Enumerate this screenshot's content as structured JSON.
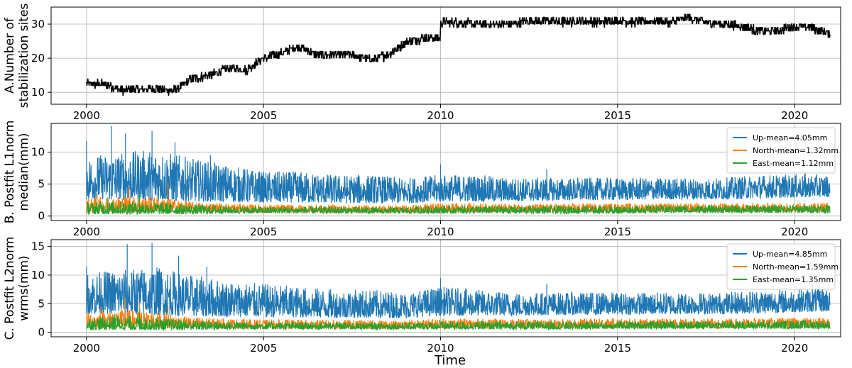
{
  "figure": {
    "xlabel": "Time"
  },
  "chart_data": [
    {
      "id": "A",
      "type": "line",
      "ylabel_lines": [
        "A.Number of",
        "stabilization sites"
      ],
      "xlim": [
        1999.0,
        2021.3
      ],
      "ylim": [
        6.5,
        35
      ],
      "xticks": [
        2000,
        2005,
        2010,
        2015,
        2020
      ],
      "yticks": [
        10,
        20,
        30
      ],
      "grid": true,
      "series": [
        {
          "color": "#000000",
          "noise": 1.3,
          "x": [
            2000.0,
            2000.5,
            2001.0,
            2001.5,
            2002.0,
            2002.5,
            2003.0,
            2003.5,
            2004.0,
            2004.5,
            2005.0,
            2005.5,
            2006.0,
            2006.5,
            2007.0,
            2007.5,
            2008.0,
            2008.5,
            2009.0,
            2009.5,
            2009.99,
            2010.01,
            2010.5,
            2011.0,
            2011.5,
            2012.0,
            2012.5,
            2013.0,
            2013.5,
            2014.0,
            2014.5,
            2015.0,
            2015.5,
            2016.0,
            2016.5,
            2017.0,
            2017.5,
            2018.0,
            2018.5,
            2019.0,
            2019.5,
            2020.0,
            2020.5,
            2021.0
          ],
          "y": [
            12.5,
            12.5,
            10.5,
            11.0,
            11.0,
            10.5,
            14.0,
            15.0,
            17.0,
            16.5,
            20.0,
            21.5,
            23.5,
            21.0,
            21.0,
            21.0,
            19.5,
            21.0,
            24.5,
            26.0,
            26.0,
            30.5,
            30.5,
            30.0,
            30.0,
            30.0,
            31.0,
            31.0,
            30.5,
            31.0,
            30.5,
            31.0,
            30.5,
            31.0,
            30.5,
            32.0,
            30.5,
            30.0,
            29.5,
            28.0,
            28.0,
            29.5,
            29.0,
            27.0
          ]
        }
      ]
    },
    {
      "id": "B",
      "type": "line",
      "ylabel_lines": [
        "B. Postfit L1norm",
        "median(mm)"
      ],
      "xlim": [
        1999.0,
        2021.3
      ],
      "ylim": [
        -0.7,
        14.5
      ],
      "xticks": [
        2000,
        2005,
        2010,
        2015,
        2020
      ],
      "yticks": [
        0,
        5,
        10
      ],
      "grid": true,
      "series": [
        {
          "name": "Up-mean=4.05mm",
          "color": "#1f77b4",
          "x": [
            2000,
            2001,
            2002,
            2003,
            2004,
            2005,
            2006,
            2007,
            2008,
            2009,
            2010,
            2011,
            2012,
            2013,
            2014,
            2015,
            2016,
            2017,
            2018,
            2019,
            2020,
            2021
          ],
          "y_low": [
            2.6,
            2.6,
            2.4,
            2.3,
            2.2,
            2.1,
            2.1,
            2.0,
            2.0,
            2.0,
            2.3,
            2.3,
            2.3,
            2.4,
            2.5,
            2.5,
            2.6,
            2.6,
            2.6,
            2.8,
            2.9,
            3.0
          ],
          "y_high": [
            9.5,
            10.0,
            10.5,
            9.0,
            8.0,
            7.0,
            7.0,
            6.5,
            6.5,
            6.0,
            6.5,
            6.5,
            6.0,
            6.0,
            6.0,
            6.0,
            6.0,
            6.0,
            6.0,
            6.5,
            6.5,
            6.5
          ],
          "spikes": [
            [
              2000.0,
              11.7
            ],
            [
              2000.7,
              14.1
            ],
            [
              2001.1,
              12.9
            ],
            [
              2001.85,
              13.3
            ],
            [
              2002.5,
              11.5
            ],
            [
              2003.5,
              9.5
            ],
            [
              2010.0,
              8.1
            ],
            [
              2013.0,
              7.3
            ],
            [
              2020.3,
              7.0
            ]
          ]
        },
        {
          "name": "North-mean=1.32mm",
          "color": "#ff7f0e",
          "x": [
            2000,
            2001,
            2002,
            2003,
            2004,
            2005,
            2006,
            2007,
            2008,
            2009,
            2010,
            2011,
            2012,
            2013,
            2014,
            2015,
            2016,
            2017,
            2018,
            2019,
            2020,
            2021
          ],
          "y_low": [
            0.6,
            0.6,
            0.6,
            0.6,
            0.6,
            0.5,
            0.5,
            0.5,
            0.5,
            0.5,
            0.6,
            0.6,
            0.6,
            0.6,
            0.6,
            0.6,
            0.6,
            0.6,
            0.6,
            0.6,
            0.7,
            0.7
          ],
          "y_high": [
            2.8,
            3.2,
            3.0,
            2.2,
            2.0,
            1.8,
            1.8,
            1.8,
            1.7,
            1.7,
            2.0,
            2.0,
            1.9,
            1.9,
            2.0,
            2.0,
            2.0,
            2.0,
            2.0,
            2.0,
            2.1,
            2.2
          ],
          "spikes": [
            [
              2001.2,
              4.6
            ],
            [
              2002.3,
              5.3
            ],
            [
              2000.3,
              3.5
            ]
          ]
        },
        {
          "name": "East-mean=1.12mm",
          "color": "#2ca02c",
          "x": [
            2000,
            2001,
            2002,
            2003,
            2004,
            2005,
            2006,
            2007,
            2008,
            2009,
            2010,
            2011,
            2012,
            2013,
            2014,
            2015,
            2016,
            2017,
            2018,
            2019,
            2020,
            2021
          ],
          "y_low": [
            0.3,
            0.3,
            0.3,
            0.3,
            0.4,
            0.4,
            0.4,
            0.4,
            0.4,
            0.4,
            0.4,
            0.4,
            0.4,
            0.4,
            0.4,
            0.4,
            0.5,
            0.5,
            0.5,
            0.5,
            0.5,
            0.5
          ],
          "y_high": [
            2.2,
            2.4,
            2.2,
            1.8,
            1.6,
            1.5,
            1.5,
            1.5,
            1.4,
            1.4,
            1.6,
            1.6,
            1.6,
            1.6,
            1.6,
            1.6,
            1.7,
            1.7,
            1.7,
            1.7,
            1.8,
            1.8
          ],
          "spikes": [
            [
              2001.5,
              3.4
            ],
            [
              2000.6,
              2.9
            ]
          ]
        }
      ]
    },
    {
      "id": "C",
      "type": "line",
      "ylabel_lines": [
        "C. Postfit L2norm",
        "wrms(mm)"
      ],
      "xlim": [
        1999.0,
        2021.3
      ],
      "ylim": [
        -0.8,
        16.2
      ],
      "xticks": [
        2000,
        2005,
        2010,
        2015,
        2020
      ],
      "yticks": [
        0,
        5,
        10,
        15
      ],
      "grid": true,
      "series": [
        {
          "name": "Up-mean=4.85mm",
          "color": "#1f77b4",
          "x": [
            2000,
            2001,
            2002,
            2003,
            2004,
            2005,
            2006,
            2007,
            2008,
            2009,
            2010,
            2011,
            2012,
            2013,
            2014,
            2015,
            2016,
            2017,
            2018,
            2019,
            2020,
            2021
          ],
          "y_low": [
            3.2,
            3.2,
            3.0,
            2.8,
            2.7,
            2.6,
            2.6,
            2.5,
            2.5,
            2.5,
            2.9,
            2.9,
            2.9,
            3.0,
            3.0,
            3.1,
            3.1,
            3.2,
            3.2,
            3.3,
            3.5,
            3.6
          ],
          "y_high": [
            10.5,
            11.0,
            11.5,
            10.0,
            9.0,
            8.5,
            8.0,
            7.5,
            7.5,
            7.0,
            8.0,
            7.5,
            7.0,
            7.0,
            7.0,
            7.0,
            7.0,
            7.0,
            7.0,
            7.5,
            7.5,
            8.0
          ],
          "spikes": [
            [
              2000.0,
              11.5
            ],
            [
              2001.15,
              15.4
            ],
            [
              2001.85,
              15.6
            ],
            [
              2002.6,
              13.4
            ],
            [
              2003.4,
              11.5
            ],
            [
              2010.0,
              9.5
            ],
            [
              2013.0,
              8.5
            ],
            [
              2020.5,
              8.6
            ]
          ]
        },
        {
          "name": "North-mean=1.59mm",
          "color": "#ff7f0e",
          "x": [
            2000,
            2001,
            2002,
            2003,
            2004,
            2005,
            2006,
            2007,
            2008,
            2009,
            2010,
            2011,
            2012,
            2013,
            2014,
            2015,
            2016,
            2017,
            2018,
            2019,
            2020,
            2021
          ],
          "y_low": [
            0.7,
            0.7,
            0.7,
            0.7,
            0.7,
            0.6,
            0.6,
            0.6,
            0.6,
            0.6,
            0.7,
            0.7,
            0.7,
            0.7,
            0.7,
            0.7,
            0.7,
            0.7,
            0.7,
            0.8,
            0.8,
            0.8
          ],
          "y_high": [
            3.5,
            4.0,
            3.5,
            2.6,
            2.4,
            2.2,
            2.2,
            2.2,
            2.1,
            2.1,
            2.4,
            2.4,
            2.3,
            2.3,
            2.4,
            2.4,
            2.4,
            2.4,
            2.4,
            2.5,
            2.5,
            2.6
          ],
          "spikes": [
            [
              2001.1,
              6.0
            ],
            [
              2001.5,
              5.2
            ],
            [
              2002.3,
              4.8
            ],
            [
              2000.4,
              4.5
            ]
          ]
        },
        {
          "name": "East-mean=1.35mm",
          "color": "#2ca02c",
          "x": [
            2000,
            2001,
            2002,
            2003,
            2004,
            2005,
            2006,
            2007,
            2008,
            2009,
            2010,
            2011,
            2012,
            2013,
            2014,
            2015,
            2016,
            2017,
            2018,
            2019,
            2020,
            2021
          ],
          "y_low": [
            0.4,
            0.4,
            0.4,
            0.4,
            0.5,
            0.5,
            0.5,
            0.5,
            0.5,
            0.5,
            0.5,
            0.5,
            0.5,
            0.5,
            0.5,
            0.6,
            0.6,
            0.6,
            0.6,
            0.6,
            0.6,
            0.6
          ],
          "y_high": [
            2.6,
            2.9,
            2.6,
            2.1,
            1.9,
            1.8,
            1.8,
            1.8,
            1.7,
            1.7,
            1.9,
            1.9,
            1.9,
            1.9,
            1.9,
            1.9,
            2.0,
            2.0,
            2.0,
            2.0,
            2.1,
            2.1
          ],
          "spikes": [
            [
              2001.5,
              4.0
            ],
            [
              2000.8,
              3.3
            ]
          ]
        }
      ]
    }
  ]
}
